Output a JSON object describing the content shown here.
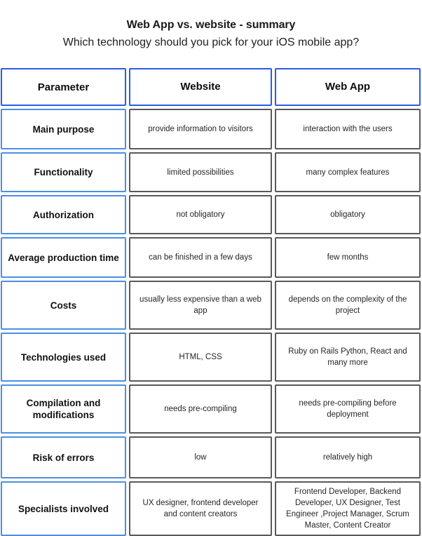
{
  "heading": {
    "title": "Web App vs. website - summary",
    "subtitle": "Which technology should you pick for your iOS mobile app?"
  },
  "colors": {
    "header_border": "#2b5ce6",
    "param_border": "#4a90e2",
    "value_border": "#595959",
    "background": "#ffffff",
    "text": "#1a1a1a"
  },
  "table": {
    "columns": [
      "Parameter",
      "Website",
      "Web App"
    ],
    "rows": [
      {
        "parameter": "Main purpose",
        "website": "provide information to visitors",
        "webapp": "interaction with the users"
      },
      {
        "parameter": "Functionality",
        "website": "limited possibilities",
        "webapp": "many complex features"
      },
      {
        "parameter": "Authorization",
        "website": "not obligatory",
        "webapp": "obligatory"
      },
      {
        "parameter": "Average production time",
        "website": "can be finished in a few days",
        "webapp": "few months"
      },
      {
        "parameter": "Costs",
        "website": "usually less expensive than a web app",
        "webapp": "depends on the complexity of the project"
      },
      {
        "parameter": "Technologies used",
        "website": "HTML, CSS",
        "webapp": "Ruby on Rails Python, React and many more"
      },
      {
        "parameter": "Compilation and modifications",
        "website": "needs pre-compiling",
        "webapp": "needs pre-compiling before deployment"
      },
      {
        "parameter": "Risk of errors",
        "website": "low",
        "webapp": "relatively high"
      },
      {
        "parameter": "Specialists involved",
        "website": "UX designer, frontend developer and content creators",
        "webapp": "Frontend Developer, Backend Developer, UX Designer, Test Engineer ,Project Manager, Scrum Master, Content Creator"
      }
    ]
  }
}
